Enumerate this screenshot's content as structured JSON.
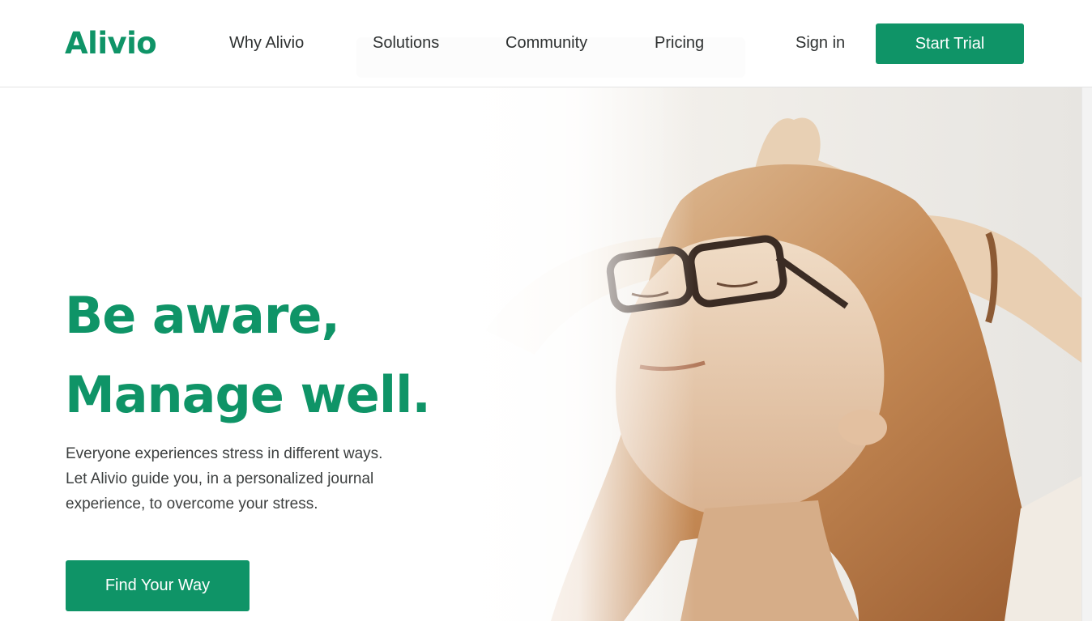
{
  "header": {
    "logo": "Alivio",
    "nav": {
      "why": "Why Alivio",
      "solutions": "Solutions",
      "community": "Community",
      "pricing": "Pricing",
      "signin": "Sign in"
    },
    "start_trial": "Start Trial"
  },
  "hero": {
    "headline_line1": "Be aware,",
    "headline_line2": "Manage well.",
    "subtext_line1": "Everyone experiences stress in different ways.",
    "subtext_line2": "Let Alivio guide you, in a personalized journal",
    "subtext_line3": "experience, to overcome your stress.",
    "cta": "Find Your Way",
    "image_icon": "woman-relaxing-photo"
  },
  "colors": {
    "brand": "#0f9467",
    "text": "#2e3131",
    "background": "#ffffff"
  }
}
